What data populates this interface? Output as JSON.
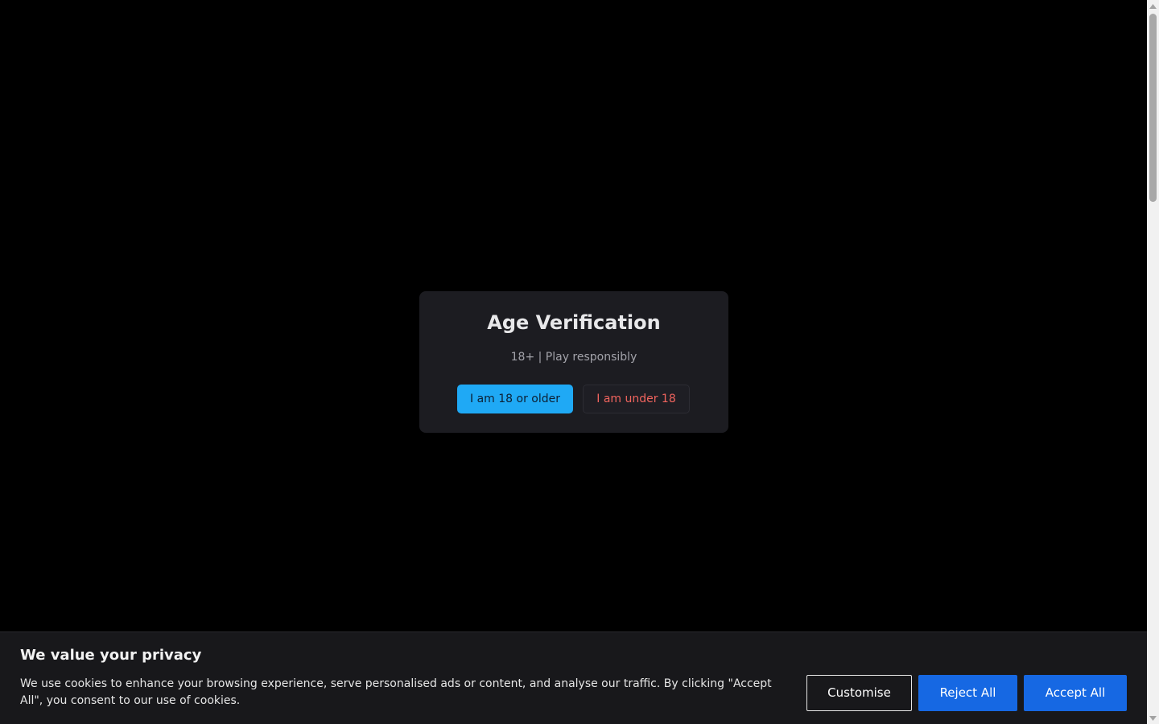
{
  "age_verification": {
    "title": "Age Verification",
    "subtitle": "18+ | Play responsibly",
    "confirm_label": "I am 18 or older",
    "deny_label": "I am under 18"
  },
  "cookie_banner": {
    "title": "We value your privacy",
    "text": "We use cookies to enhance your browsing experience, serve personalised ads or content, and analyse our traffic. By clicking \"Accept All\", you consent to our use of cookies.",
    "customise_label": "Customise",
    "reject_label": "Reject All",
    "accept_label": "Accept All"
  },
  "colors": {
    "background": "#000000",
    "modal_bg": "#1c1c21",
    "confirm_accent": "#1fa9f5",
    "deny_text": "#f0645e",
    "cookie_button": "#1668e3"
  },
  "icons": {
    "scroll_up": "triangle-up-icon",
    "scroll_down": "triangle-down-icon"
  }
}
